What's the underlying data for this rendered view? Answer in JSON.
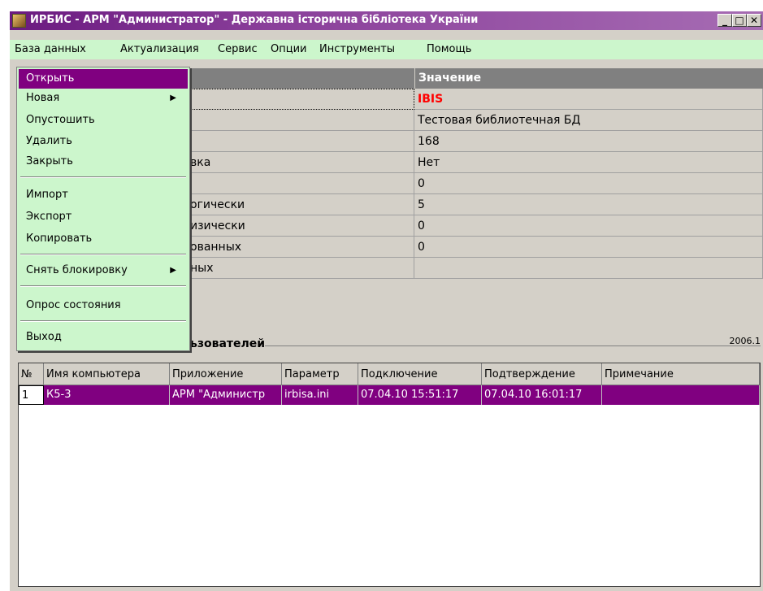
{
  "window": {
    "title": "ИРБИС - АРМ \"Администратор\" - Державна історична бібліотека України",
    "min_label": "_",
    "max_label": "□",
    "close_label": "✕"
  },
  "menubar": {
    "items": [
      "База данных",
      "Актуализация",
      "Сервис",
      "Опции",
      "Инструменты",
      "Помощь"
    ]
  },
  "dropdown": {
    "items": [
      "Открыть",
      "Новая",
      "Опустошить",
      "Удалить",
      "Закрыть",
      "Импорт",
      "Экспорт",
      "Копировать",
      "Снять блокировку",
      "Опрос состояния",
      "Выход"
    ],
    "submenu_arrow": "▶"
  },
  "properties": {
    "header_value": "Значение",
    "rows": [
      {
        "name": "",
        "value": "IBIS"
      },
      {
        "name": "",
        "value": "Тестовая библиотечная БД"
      },
      {
        "name": "",
        "value": "168"
      },
      {
        "name": "вка",
        "value": "Нет"
      },
      {
        "name": "",
        "value": "0"
      },
      {
        "name": "огически",
        "value": "5"
      },
      {
        "name": "изически",
        "value": "0"
      },
      {
        "name": "ованных",
        "value": "0"
      },
      {
        "name": "ных",
        "value": ""
      }
    ],
    "accent_value_color": "#ff0000"
  },
  "users_section": {
    "label": "ьзователей",
    "date_fragment": "2006.1"
  },
  "grid": {
    "columns": [
      "№",
      "Имя компьютера",
      "Приложение",
      "Параметр",
      "Подключение",
      "Подтверждение",
      "Примечание"
    ],
    "rows": [
      [
        "1",
        "К5-3",
        "АРМ \"Администр",
        "irbisa.ini",
        "07.04.10 15:51:17",
        "07.04.10 16:01:17",
        ""
      ]
    ]
  },
  "colors": {
    "menu_bg": "#ccf6cc",
    "selection": "#800080",
    "title_start": "#6b1a80"
  }
}
